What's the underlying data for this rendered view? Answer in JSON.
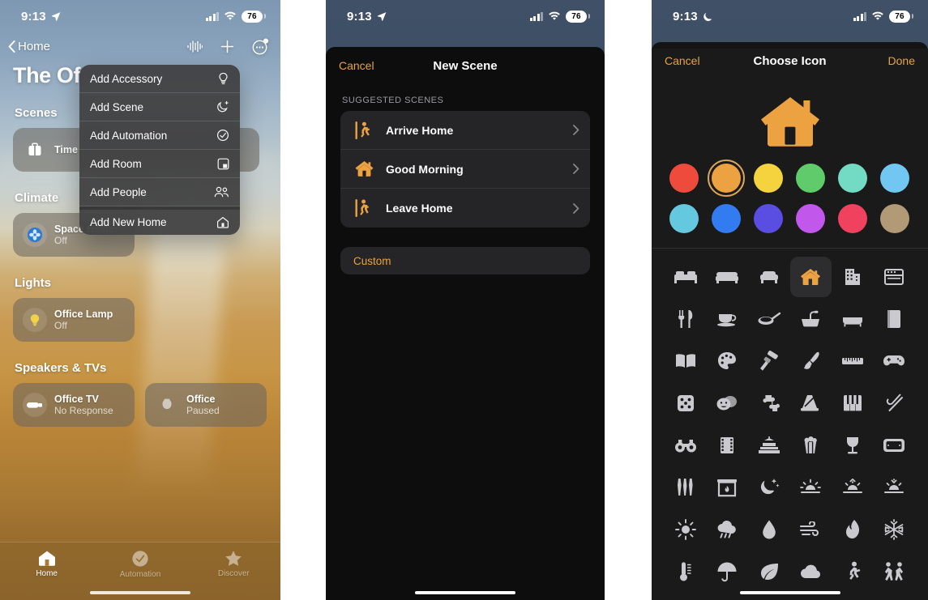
{
  "panel1": {
    "status": {
      "time": "9:13",
      "location_icon": "location-arrow-icon",
      "battery": "76"
    },
    "nav": {
      "back_label": "Home",
      "icons": [
        "waveform-icon",
        "plus-icon",
        "more-ellipsis-icon"
      ]
    },
    "title": "The Of",
    "context_menu": {
      "items": [
        {
          "label": "Add Accessory",
          "icon": "lightbulb-icon"
        },
        {
          "label": "Add Scene",
          "icon": "moon-stars-icon"
        },
        {
          "label": "Add Automation",
          "icon": "automation-clock-icon"
        },
        {
          "label": "Add Room",
          "icon": "room-square-icon"
        },
        {
          "label": "Add People",
          "icon": "people-icon"
        },
        {
          "label": "Add New Home",
          "icon": "house-icon"
        }
      ]
    },
    "sections": [
      {
        "title": "Scenes",
        "tiles": [
          {
            "name": "Time",
            "state": "",
            "icon": "briefcase-icon",
            "wide": true
          }
        ]
      },
      {
        "title": "Climate",
        "tiles": [
          {
            "name": "Space Heater",
            "state": "Off",
            "icon": "fan-heater-icon",
            "wide": false
          }
        ]
      },
      {
        "title": "Lights",
        "tiles": [
          {
            "name": "Office Lamp",
            "state": "Off",
            "icon": "lightbulb-on-icon",
            "wide": false
          }
        ]
      },
      {
        "title": "Speakers & TVs",
        "tiles": [
          {
            "name": "Office TV",
            "state": "No Response",
            "icon": "appletv-icon",
            "wide": false
          },
          {
            "name": "Office",
            "state": "Paused",
            "icon": "homepod-icon",
            "wide": false
          }
        ]
      }
    ],
    "tabs": [
      {
        "label": "Home",
        "icon": "house-tab-icon",
        "active": true
      },
      {
        "label": "Automation",
        "icon": "automation-tab-icon",
        "active": false
      },
      {
        "label": "Discover",
        "icon": "star-tab-icon",
        "active": false
      }
    ]
  },
  "panel2": {
    "status": {
      "time": "9:13",
      "location_icon": "location-arrow-icon",
      "battery": "76"
    },
    "sheet": {
      "cancel_label": "Cancel",
      "title": "New Scene",
      "group_label": "SUGGESTED SCENES",
      "scenes": [
        {
          "label": "Arrive Home",
          "icon": "walking-in-icon"
        },
        {
          "label": "Good Morning",
          "icon": "house-orange-icon"
        },
        {
          "label": "Leave Home",
          "icon": "walking-out-icon"
        }
      ],
      "custom_label": "Custom"
    }
  },
  "panel3": {
    "status": {
      "time": "9:13",
      "moon_icon": "crescent-moon-icon",
      "battery": "76"
    },
    "sheet": {
      "cancel_label": "Cancel",
      "title": "Choose Icon",
      "done_label": "Done",
      "preview_icon": "house-icon",
      "preview_color": "#eda242",
      "colors": [
        {
          "name": "red",
          "hex": "#ef4b3c",
          "selected": false
        },
        {
          "name": "orange",
          "hex": "#eda242",
          "selected": true
        },
        {
          "name": "yellow",
          "hex": "#f4d33e",
          "selected": false
        },
        {
          "name": "green",
          "hex": "#5fcb6a",
          "selected": false
        },
        {
          "name": "mint",
          "hex": "#73dbc4",
          "selected": false
        },
        {
          "name": "light-blue",
          "hex": "#72c6f2",
          "selected": false
        },
        {
          "name": "cyan",
          "hex": "#64c8de",
          "selected": false
        },
        {
          "name": "blue",
          "hex": "#337bf0",
          "selected": false
        },
        {
          "name": "indigo",
          "hex": "#5a4de2",
          "selected": false
        },
        {
          "name": "purple",
          "hex": "#c257ec",
          "selected": false
        },
        {
          "name": "pink",
          "hex": "#f0415f",
          "selected": false
        },
        {
          "name": "brown",
          "hex": "#b39a76",
          "selected": false
        }
      ],
      "icons": [
        "bed-icon",
        "sofa-icon",
        "armchair-icon",
        "house-icon",
        "building-icon",
        "oven-icon",
        "fork-knife-icon",
        "teacup-icon",
        "pan-icon",
        "sink-icon",
        "bathtub-icon",
        "book-closed-icon",
        "book-open-icon",
        "palette-icon",
        "paint-roller-icon",
        "paintbrush-icon",
        "ruler-icon",
        "gamepad-icon",
        "dice-icon",
        "theater-masks-icon",
        "puzzle-icon",
        "metronome-icon",
        "piano-icon",
        "tuning-fork-icon",
        "binoculars-icon",
        "film-strip-icon",
        "cake-icon",
        "popcorn-icon",
        "wine-glass-icon",
        "video-box-icon",
        "tools-icon",
        "fireplace-icon",
        "moon-stars-icon",
        "sunset-icon",
        "sunrise-icon",
        "sundown-icon",
        "sun-icon",
        "rain-cloud-icon",
        "water-drop-icon",
        "wind-icon",
        "flame-icon",
        "snowflake-icon",
        "thermometer-icon",
        "umbrella-icon",
        "leaf-icon",
        "cloud-icon",
        "running-person-icon",
        "people-dance-icon"
      ],
      "selected_icon_index": 3
    }
  }
}
